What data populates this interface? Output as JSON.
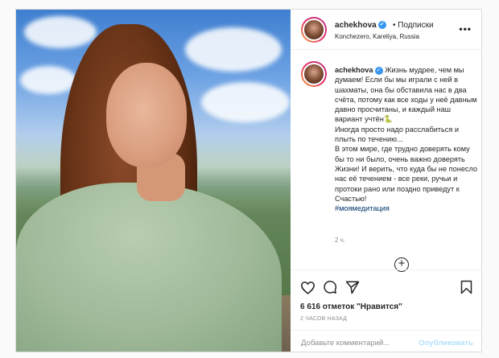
{
  "header": {
    "username": "achekhova",
    "follow_label": "• Подписки",
    "location": "Konchezero, Kareliya, Russia",
    "more_icon": "more-horizontal-icon"
  },
  "caption": {
    "username": "achekhova",
    "text_part1": "Жизнь мудрее, чем мы думаем! Если бы мы играли с ней в шахматы, она бы обставила нас в два счёта, потому как все ходы у неё давным давно просчитаны, и каждый наш вариант учтён",
    "emoji": "🐍",
    "text_part2": "Иногда просто надо расслабиться и плыть по течению...",
    "text_part3": "В этом мире, где трудно доверять кому бы то ни было, очень важно доверять Жизни! И верить, что куда бы не понесло нас её течением - все реки, ручьи и протоки рано или поздно приведут к Счастью!",
    "hashtag": "#моямедитация",
    "time": "2 ч."
  },
  "actions": {
    "like_icon": "heart-icon",
    "comment_icon": "comment-icon",
    "share_icon": "paper-plane-icon",
    "save_icon": "bookmark-icon",
    "likes_count": "6 616 отметок \"Нравится\"",
    "posted_ago": "2 ЧАСОВ НАЗАД"
  },
  "comment_box": {
    "placeholder": "Добавьте комментарий...",
    "publish_label": "Опубликовать"
  },
  "colors": {
    "verified": "#3897f0",
    "hashtag": "#00376b",
    "publish": "#b2dffc",
    "border": "#dbdbdb"
  }
}
